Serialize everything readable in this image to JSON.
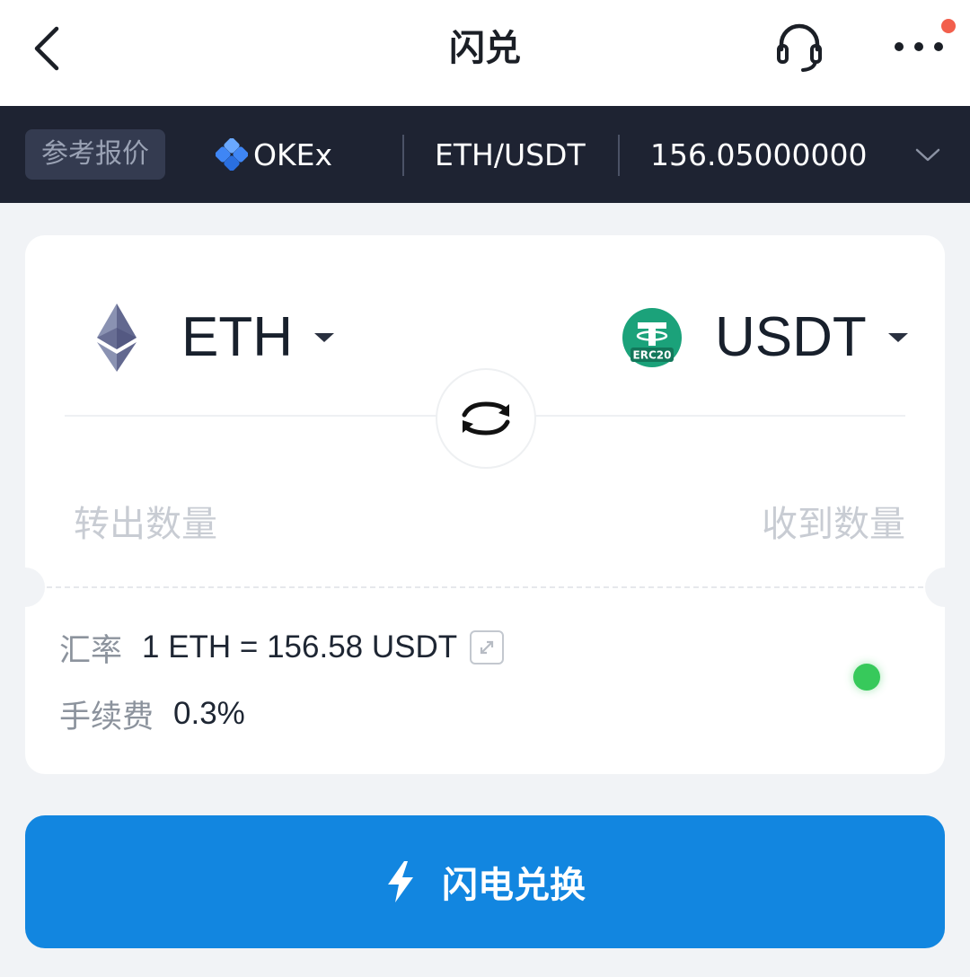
{
  "header": {
    "title": "闪兑",
    "back_icon": "chevron-left-icon",
    "support_icon": "headset-icon",
    "more_icon": "more-dots-icon",
    "notification_color": "#f25f4c"
  },
  "quote": {
    "label": "参考报价",
    "exchange_name": "OKEx",
    "exchange_icon": "okex-logo-icon",
    "pair": "ETH/USDT",
    "price": "156.05000000",
    "expand_icon": "chevron-down-icon"
  },
  "swap": {
    "from": {
      "symbol": "ETH",
      "icon": "ethereum-icon"
    },
    "to": {
      "symbol": "USDT",
      "icon": "tether-erc20-icon",
      "badge": "ERC20"
    },
    "swap_icon": "swap-arrows-icon",
    "amount_out_placeholder": "转出数量",
    "amount_in_placeholder": "收到数量"
  },
  "info": {
    "rate_label": "汇率",
    "rate_value": "1 ETH = 156.58 USDT",
    "fee_label": "手续费",
    "fee_value": "0.3%",
    "status_color": "#37c95b"
  },
  "action": {
    "label": "闪电兑换",
    "icon": "lightning-icon",
    "color": "#1286e0"
  }
}
